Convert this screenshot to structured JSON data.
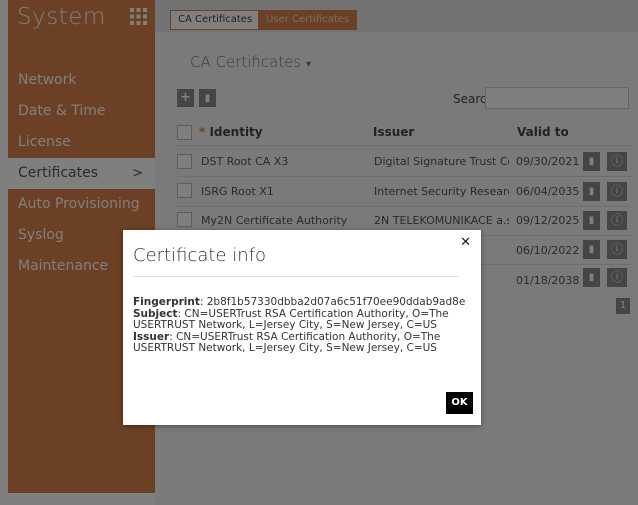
{
  "sidebar": {
    "title": "System",
    "items": [
      {
        "label": "Network"
      },
      {
        "label": "Date & Time"
      },
      {
        "label": "License"
      },
      {
        "label": "Certificates",
        "chevron": ">"
      },
      {
        "label": "Auto Provisioning"
      },
      {
        "label": "Syslog"
      },
      {
        "label": "Maintenance"
      }
    ]
  },
  "tabs": [
    {
      "label": "CA Certificates"
    },
    {
      "label": "User Certificates"
    }
  ],
  "panel": {
    "title": "CA Certificates",
    "title_caret": "▾",
    "search_label": "Search"
  },
  "table": {
    "headers": {
      "identity": "Identity",
      "issuer": "Issuer",
      "valid_to": "Valid to"
    },
    "rows": [
      {
        "identity": "DST Root CA X3",
        "issuer": "Digital Signature Trust Co.",
        "valid_to": "09/30/2021"
      },
      {
        "identity": "ISRG Root X1",
        "issuer": "Internet Security Research ...",
        "valid_to": "06/04/2035"
      },
      {
        "identity": "My2N Certificate Authority",
        "issuer": "2N TELEKOMUNIKACE a.s.",
        "valid_to": "09/12/2025"
      },
      {
        "identity": "",
        "issuer": "...",
        "valid_to": "06/10/2022"
      },
      {
        "identity": "",
        "issuer": "...",
        "valid_to": "01/18/2038"
      }
    ],
    "pager": "1"
  },
  "modal": {
    "title": "Certificate info",
    "close_icon": "close-icon",
    "fingerprint_label": "Fingerprint",
    "fingerprint_value": "2b8f1b57330dbba2d07a6c51f70ee90ddab9ad8e",
    "subject_label": "Subject",
    "subject_value": "CN=USERTrust RSA Certification Authority, O=The USERTRUST Network, L=Jersey City, S=New Jersey, C=US",
    "issuer_label": "Issuer",
    "issuer_value": "CN=USERTrust RSA Certification Authority, O=The USERTRUST Network, L=Jersey City, S=New Jersey, C=US",
    "ok_label": "OK"
  },
  "colors": {
    "accent": "#d9804a",
    "overlay": "rgba(0,0,0,0.5)"
  }
}
